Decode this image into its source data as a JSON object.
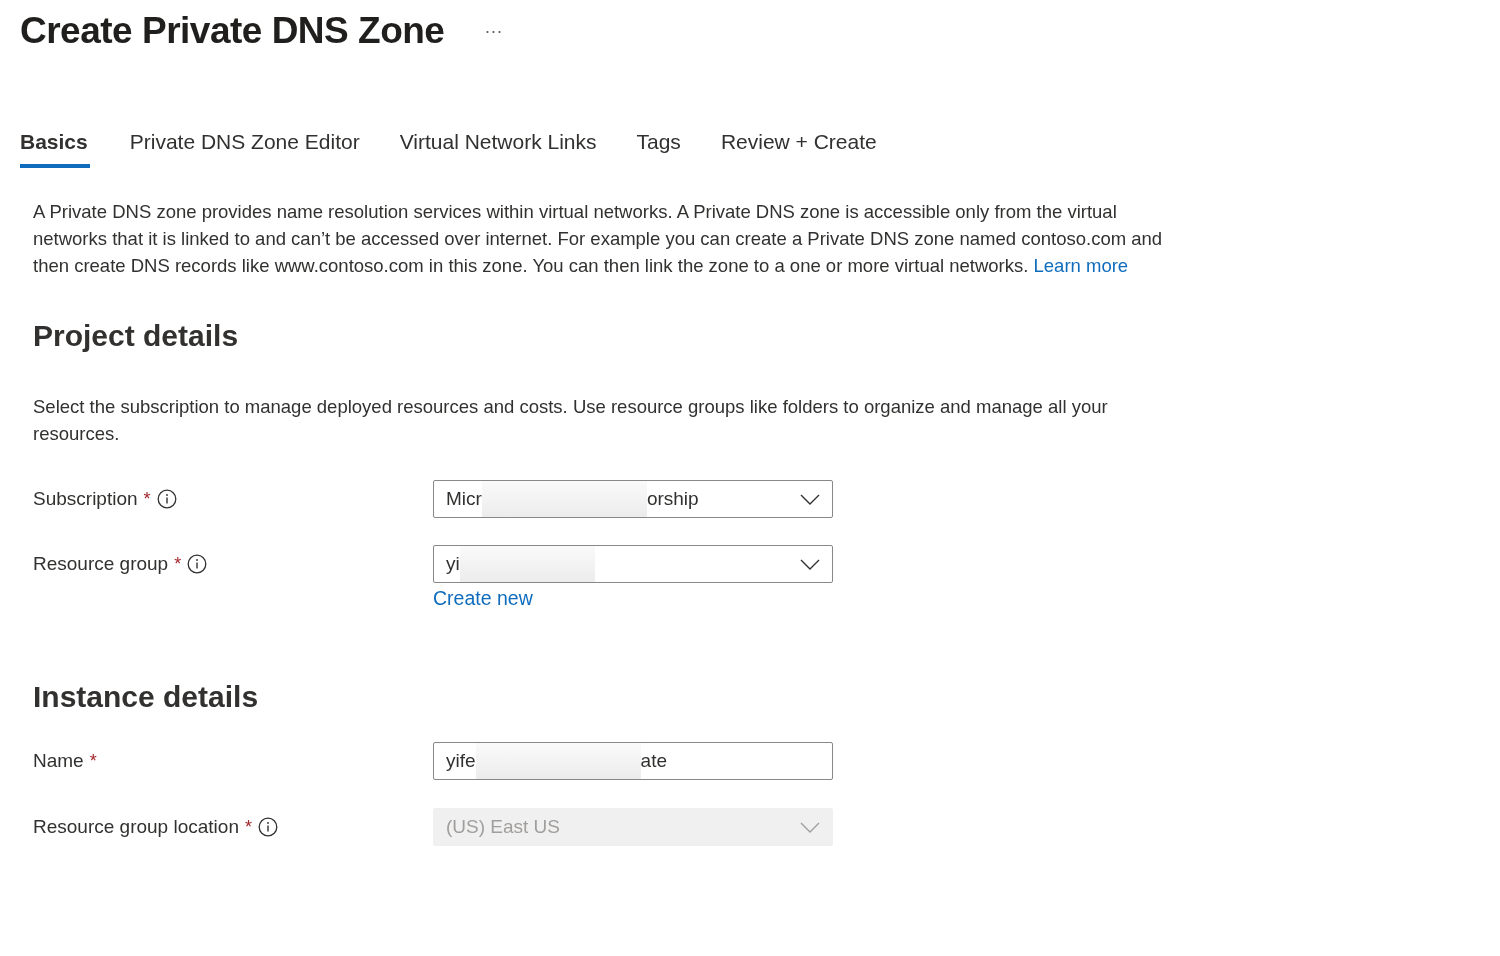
{
  "title": "Create Private DNS Zone",
  "more": "···",
  "tabs": [
    {
      "label": "Basics",
      "selected": true
    },
    {
      "label": "Private DNS Zone Editor",
      "selected": false
    },
    {
      "label": "Virtual Network Links",
      "selected": false
    },
    {
      "label": "Tags",
      "selected": false
    },
    {
      "label": "Review + Create",
      "selected": false
    }
  ],
  "intro": {
    "text": "A Private DNS zone provides name resolution services within virtual networks. A Private DNS zone is accessible only from the virtual networks that it is linked to and can’t be accessed over internet. For example you can create a Private DNS zone named contoso.com and then create DNS records like www.contoso.com in this zone. You can then link the zone to a one or more virtual networks.",
    "link": "Learn more"
  },
  "sections": [
    {
      "heading": "Project details",
      "description": "Select the subscription to manage deployed resources and costs. Use resource groups like folders to organize and manage all your resources.",
      "fields": [
        {
          "label": "Subscription",
          "required": "*",
          "info": true,
          "kind": "dropdown",
          "disabled": false,
          "value_parts": [
            "Micr",
            "orship"
          ]
        },
        {
          "label": "Resource group",
          "required": "*",
          "info": true,
          "kind": "dropdown",
          "disabled": false,
          "value_parts": [
            "yi"
          ],
          "link": "Create new"
        }
      ]
    },
    {
      "heading": "Instance details",
      "fields": [
        {
          "label": "Name",
          "required": "*",
          "kind": "text",
          "disabled": false,
          "value_parts": [
            "yife",
            "ate"
          ]
        },
        {
          "label": "Resource group location",
          "required": "*",
          "info": true,
          "kind": "dropdown",
          "disabled": true,
          "value_parts": [
            "(US) East US"
          ]
        }
      ]
    }
  ]
}
